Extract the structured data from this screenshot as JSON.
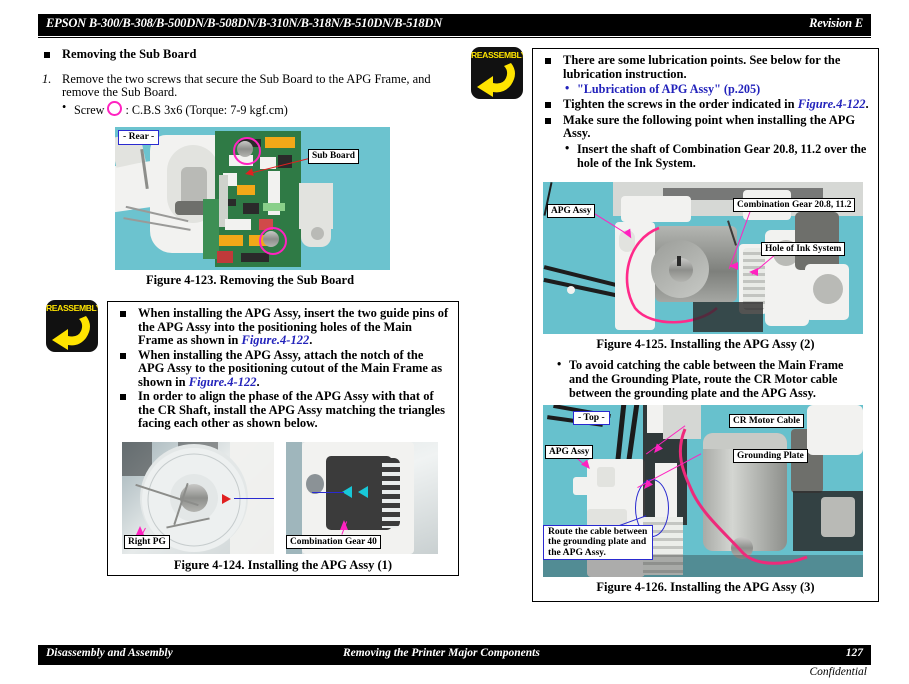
{
  "header": {
    "title": "EPSON B-300/B-308/B-500DN/B-508DN/B-310N/B-318N/B-510DN/B-518DN",
    "revision": "Revision E"
  },
  "footer": {
    "left": "Disassembly and Assembly",
    "middle": "Removing the Printer Major Components",
    "page": "127",
    "confidential": "Confidential"
  },
  "left_column": {
    "section_heading": "Removing the Sub Board",
    "step": {
      "number": "1.",
      "text": "Remove the two screws that secure the Sub Board to the APG Frame, and remove the Sub Board."
    },
    "screw_line": {
      "prefix": "Screw",
      "suffix": ": C.B.S 3x6 (Torque: 7-9 kgf.cm)"
    },
    "figure_123": {
      "caption": "Figure 4-123.  Removing the Sub Board",
      "labels": {
        "orientation": "- Rear -",
        "sub_board": "Sub Board"
      }
    },
    "note": {
      "icon_label": "REASSEMBLY",
      "bullets": [
        {
          "pre": "When installing the APG Assy, insert the two guide pins of the APG Assy into the positioning holes of the Main Frame as shown in ",
          "ref": "Figure.4-122",
          "post": "."
        },
        {
          "pre": "When installing the APG Assy, attach the notch of the APG Assy to the positioning cutout of the Main Frame as shown in ",
          "ref": "Figure.4-122",
          "post": "."
        },
        {
          "pre": "In order to align the phase of the APG Assy with that of the CR Shaft, install the APG Assy matching the triangles facing each other as shown below.",
          "ref": "",
          "post": ""
        }
      ]
    },
    "figure_124": {
      "caption": "Figure 4-124.  Installing the APG Assy (1)",
      "labels": {
        "right_pg": "Right PG",
        "combination_gear_40": "Combination Gear 40"
      }
    }
  },
  "right_column": {
    "note": {
      "icon_label": "REASSEMBLY",
      "bullets": [
        {
          "pre": "There are some lubrication points. See below for the lubrication instruction.",
          "ref": "",
          "post": ""
        },
        {
          "pre": "Tighten the screws in the order indicated in ",
          "ref": "Figure.4-122",
          "post": "."
        },
        {
          "pre": "Make sure the following point when installing the APG Assy.",
          "ref": "",
          "post": ""
        }
      ],
      "sub_bullets": {
        "lubrication_link": "\"Lubrication of APG Assy\" (p.205)",
        "insert_shaft": "Insert the shaft of Combination Gear 20.8, 11.2 over the hole of the Ink System."
      },
      "cable_bullet": "To avoid catching the cable between the Main Frame and the Grounding Plate, route the CR Motor cable between the grounding plate and the APG Assy."
    },
    "figure_125": {
      "caption": "Figure 4-125.  Installing the APG Assy (2)",
      "labels": {
        "apg_assy": "APG Assy",
        "combination_gear": "Combination Gear 20.8, 11.2",
        "hole_of_ink_system": "Hole of Ink System"
      }
    },
    "figure_126": {
      "caption": "Figure 4-126.  Installing the APG Assy (3)",
      "labels": {
        "orientation": "- Top -",
        "apg_assy": "APG Assy",
        "cr_motor_cable": "CR Motor Cable",
        "grounding_plate": "Grounding Plate",
        "route_note": "Route the cable between the grounding plate and the APG Assy."
      }
    }
  },
  "colors": {
    "accent_magenta": "#ff22c0",
    "link_blue": "#2222bb",
    "callout_blue": "#2a2ad0",
    "photo_background": "#6cc3cf",
    "note_icon_bg": "#111111",
    "note_icon_fg": "#ffe400"
  }
}
